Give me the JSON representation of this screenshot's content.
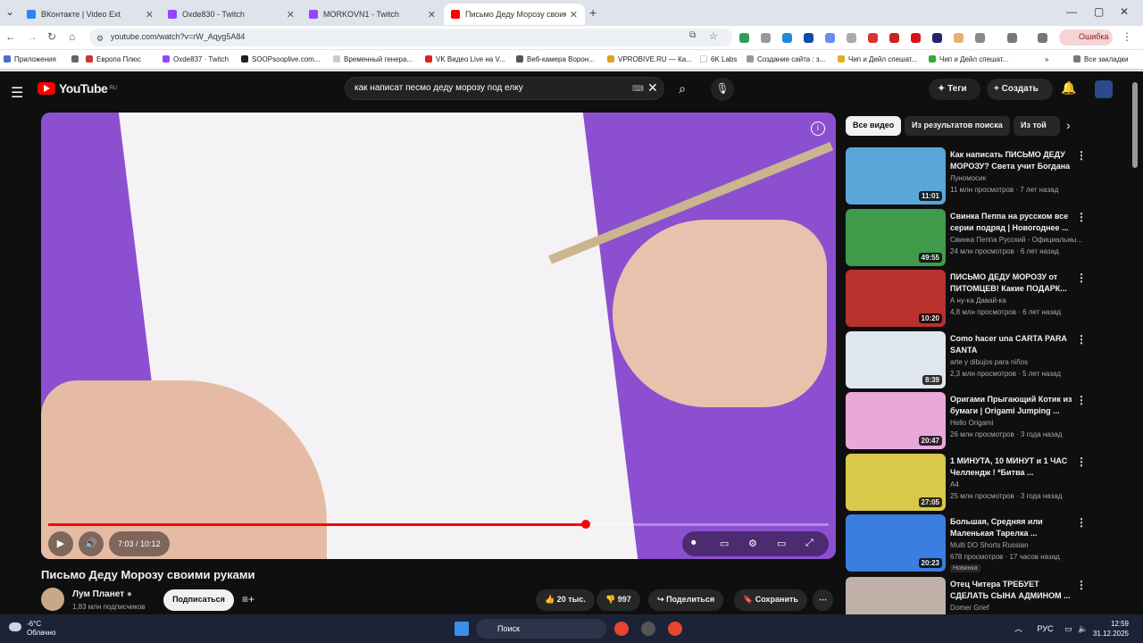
{
  "browser": {
    "tabs": [
      {
        "title": "ВКонтакте | Video Ext",
        "color": "#2787f5"
      },
      {
        "title": "Oxde830 - Twitch",
        "color": "#9146ff"
      },
      {
        "title": "MORKOVN1 - Twitch",
        "color": "#9146ff"
      },
      {
        "title": "Письмо Деду Морозу своими",
        "color": "#ff0000"
      }
    ],
    "url": "youtube.com/watch?v=rW_Aqyg5A84",
    "error_label": "Ошибка",
    "bookmarks": [
      "Приложения",
      "Европа Плюс",
      "Oxde837 · Twitch",
      "SOOPsooplive.com...",
      "Временный генера...",
      "VK Видео Live на V...",
      "Веб-камера Ворон...",
      "VPROBIVE.RU — Ка...",
      "6K Labs",
      "Создание сайта : з...",
      "Чип и Дейл спешат...",
      "Чип и Дейл спешат...",
      "Все закладки"
    ]
  },
  "youtube": {
    "logo_text": "YouTube",
    "region": "RU",
    "search_query": "как написат песмо деду морозу под елку",
    "tags_label": "Теги",
    "create_label": "Создать",
    "player": {
      "time": "7:03 / 10:12",
      "progress_fraction": 0.689,
      "buffer_fraction": 0.88
    },
    "video": {
      "title": "Письмо Деду Морозу своими руками",
      "channel": "Лум Планет",
      "subscribers": "1,83 млн подписчиков",
      "subscribe_label": "Подписаться",
      "likes": "20 тыс.",
      "dislikes": "997",
      "share_label": "Поделиться",
      "save_label": "Сохранить"
    },
    "chips": [
      "Все видео",
      "Из результатов поиска",
      "Из той"
    ],
    "recommendations": [
      {
        "title": "Как написать ПИСЬМО ДЕДУ МОРОЗУ? Света учит Богдана",
        "channel": "Луномосик",
        "meta": "11 млн просмотров · 7 лет назад",
        "duration": "11:01",
        "color": "#5aa6d8"
      },
      {
        "title": "Свинка Пеппа на русском все серии подряд | Новогоднее ...",
        "channel": "Свинка Пеппа Русский - Официальны...",
        "meta": "24 млн просмотров · 6 лет назад",
        "duration": "49:55",
        "color": "#3f9a4a"
      },
      {
        "title": "ПИСЬМО ДЕДУ МОРОЗУ от ПИТОМЦЕВ! Какие ПОДАРК...",
        "channel": "А ну-ка Давай-ка",
        "meta": "4,8 млн просмотров · 6 лет назад",
        "duration": "10:20",
        "color": "#b8312e"
      },
      {
        "title": "Como hacer una CARTA PARA SANTA",
        "channel": "arte y dibujos para niños",
        "meta": "2,3 млн просмотров · 5 лет назад",
        "duration": "8:39",
        "color": "#e0e6ee"
      },
      {
        "title": "Оригами Прыгающий Котик из бумаги | Origami Jumping ...",
        "channel": "Hello Origami",
        "meta": "26 млн просмотров · 3 года назад",
        "duration": "20:47",
        "color": "#e9a9d8"
      },
      {
        "title": "1 МИНУТА, 10 МИНУТ и 1 ЧАС Челлендж ! *Битва ...",
        "channel": "A4",
        "meta": "25 млн просмотров · 3 года назад",
        "duration": "27:05",
        "color": "#d9c84a"
      },
      {
        "title": "Большая, Средняя или Маленькая Тарелка ...",
        "channel": "Multi DO Shorts Russian",
        "meta": "678 просмотров · 17 часов назад",
        "duration": "20:23",
        "badge": "Новинка",
        "color": "#3b7de0"
      },
      {
        "title": "Отец Читера ТРЕБУЕТ СДЕЛАТЬ СЫНА АДМИНОМ ...",
        "channel": "Domer Grief",
        "meta": "",
        "duration": "",
        "color": "#c0b0a8"
      }
    ]
  },
  "taskbar": {
    "temp": "-6°C",
    "weather": "Облачно",
    "search_label": "Поиск",
    "lang": "РУС",
    "time": "12:59",
    "date": "31.12.2025"
  }
}
